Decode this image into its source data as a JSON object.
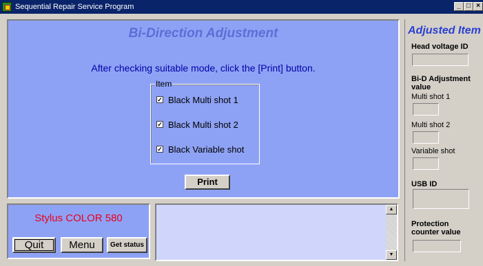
{
  "window": {
    "title": "Sequential Repair Service Program",
    "controls": {
      "minimize": "_",
      "maximize": "□",
      "close": "×"
    }
  },
  "main": {
    "title": "Bi-Direction Adjustment",
    "instruction": "After checking suitable mode, click the [Print] button.",
    "group": {
      "label": "Item",
      "items": [
        {
          "label": "Black Multi shot 1",
          "checked": true
        },
        {
          "label": "Black Multi shot 2",
          "checked": true
        },
        {
          "label": "Black Variable shot",
          "checked": true
        }
      ]
    },
    "print_label": "Print"
  },
  "model": {
    "name": "Stylus COLOR 580",
    "quit_label": "Quit",
    "menu_label": "Menu",
    "status_label": "Get status"
  },
  "log": {
    "text": ""
  },
  "side": {
    "title": "Adjusted Item",
    "head_voltage_label": "Head voltage ID",
    "bid_label": "Bi-D Adjustment value",
    "multi1_label": "Multi shot 1",
    "multi2_label": "Multi shot 2",
    "variable_label": "Variable shot",
    "usb_label": "USB ID",
    "protection_label": "Protection counter value"
  },
  "colors": {
    "panel_bg": "#8ea2f5",
    "title_blue": "#5a6fd6",
    "instruction_blue": "#0000a8",
    "model_red": "#e8001c",
    "side_title": "#2b3fd0"
  }
}
